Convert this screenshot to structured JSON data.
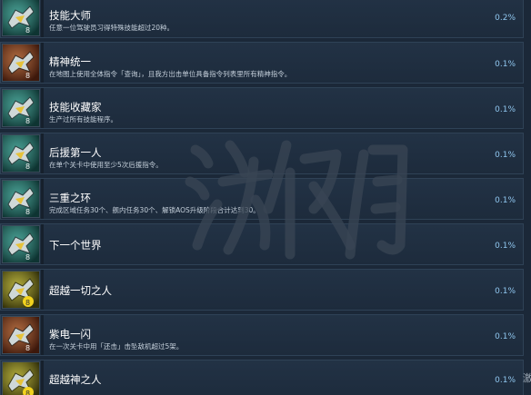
{
  "achievements": [
    {
      "title": "技能大师",
      "description": "任意一位驾驶员习得特殊技能超过20种。",
      "percent": "0.2%",
      "icon_color": "#1f6e6a"
    },
    {
      "title": "精神统一",
      "description": "在地图上使用全体指令「查询」，且我方出击单位具备指令列表里所有精神指令。",
      "percent": "0.1%",
      "icon_color": "#7a3a20"
    },
    {
      "title": "技能收藏家",
      "description": "生产过所有技能程序。",
      "percent": "0.1%",
      "icon_color": "#1f6e6a"
    },
    {
      "title": "后援第一人",
      "description": "在单个关卡中使用至少5次后援指令。",
      "percent": "0.1%",
      "icon_color": "#1f6e6a"
    },
    {
      "title": "三重之环",
      "description": "完成区域任务30个、舰内任务30个、解锁AOS升级阶段合计达到30。",
      "percent": "0.1%",
      "icon_color": "#1f6e6a"
    },
    {
      "title": "下一个世界",
      "description": "",
      "percent": "0.1%",
      "icon_color": "#1f6e6a"
    },
    {
      "title": "超越一切之人",
      "description": "",
      "percent": "0.1%",
      "icon_color": "#6d6a16"
    },
    {
      "title": "紫电一闪",
      "description": "在一次关卡中用「还击」击坠敌机超过5架。",
      "percent": "0.1%",
      "icon_color": "#7a3a20"
    },
    {
      "title": "超越神之人",
      "description": "",
      "percent": "0.1%",
      "icon_color": "#6d6a16"
    }
  ],
  "watermark_text": "游侠网",
  "edge_text": "激"
}
